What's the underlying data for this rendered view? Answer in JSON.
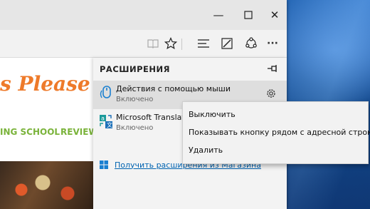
{
  "window": {
    "controls": [
      "minimize",
      "maximize",
      "close"
    ],
    "close_glyph": "✕",
    "minimize_glyph": "—",
    "maximize_glyph": "☐"
  },
  "toolbar": {
    "icons": [
      "reading-view-icon",
      "favorite-star-icon",
      "hub-icon",
      "web-note-icon",
      "share-icon",
      "more-icon"
    ],
    "more_glyph": "···"
  },
  "page": {
    "logo_text": "s Please",
    "nav_item_1": "ING SCHOOL",
    "nav_item_2": "REVIEWS"
  },
  "extensions_panel": {
    "title": "РАСШИРЕНИЯ",
    "items": [
      {
        "name": "Действия с помощью мыши",
        "status": "Включено",
        "icon": "mouse-gestures-icon"
      },
      {
        "name": "Microsoft Translator",
        "status": "Включено",
        "icon": "translator-icon"
      }
    ],
    "store_link": "Получить расширения из Магазина"
  },
  "context_menu": {
    "items": [
      "Выключить",
      "Показывать кнопку рядом с адресной строкой",
      "Удалить"
    ]
  },
  "colors": {
    "accent_blue": "#0063b1",
    "logo_orange": "#ee7a2a",
    "nav_green": "#7ab33a"
  }
}
